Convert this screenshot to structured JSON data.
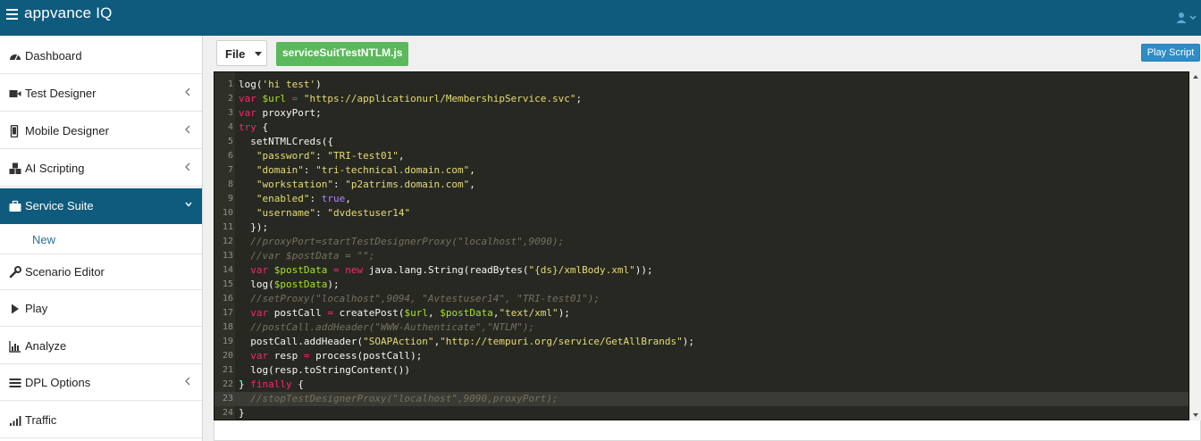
{
  "app": {
    "brand": "appvance IQ",
    "user_icon": "user-icon"
  },
  "sidebar": {
    "items": [
      {
        "label": "Dashboard",
        "icon": "dashboard-icon",
        "chevron": false,
        "active": false
      },
      {
        "label": "Test Designer",
        "icon": "video-camera-icon",
        "chevron": true,
        "active": false
      },
      {
        "label": "Mobile Designer",
        "icon": "mobile-icon",
        "chevron": true,
        "active": false
      },
      {
        "label": "AI Scripting",
        "icon": "cubes-icon",
        "chevron": true,
        "active": false
      },
      {
        "label": "Service Suite",
        "icon": "briefcase-icon",
        "chevron": true,
        "active": true
      },
      {
        "label": "Scenario Editor",
        "icon": "wrench-icon",
        "chevron": false,
        "active": false
      },
      {
        "label": "Play",
        "icon": "play-icon",
        "chevron": false,
        "active": false
      },
      {
        "label": "Analyze",
        "icon": "bar-chart-icon",
        "chevron": false,
        "active": false
      },
      {
        "label": "DPL Options",
        "icon": "list-icon",
        "chevron": true,
        "active": false
      },
      {
        "label": "Traffic",
        "icon": "signal-icon",
        "chevron": false,
        "active": false
      }
    ],
    "sub_item": {
      "label": "New"
    }
  },
  "toolbar": {
    "file_label": "File",
    "file_tab": "serviceSuitTestNTLM.js",
    "play_label": "Play Script"
  },
  "editor": {
    "lines": [
      {
        "n": "1",
        "code": "log('hi test')"
      },
      {
        "n": "2",
        "code": "var $url = \"https://applicationurl/MembershipService.svc\";"
      },
      {
        "n": "3",
        "code": "var proxyPort;"
      },
      {
        "n": "4",
        "code": "try {"
      },
      {
        "n": "5",
        "code": "  setNTMLCreds({"
      },
      {
        "n": "6",
        "code": "   \"password\": \"TRI-test01\","
      },
      {
        "n": "7",
        "code": "   \"domain\": \"tri-technical.domain.com\","
      },
      {
        "n": "8",
        "code": "   \"workstation\": \"p2atrims.domain.com\","
      },
      {
        "n": "9",
        "code": "   \"enabled\": true,"
      },
      {
        "n": "10",
        "code": "   \"username\": \"dvdestuser14\""
      },
      {
        "n": "11",
        "code": "  });"
      },
      {
        "n": "12",
        "code": "  //proxyPort=startTestDesignerProxy(\"localhost\",9090);"
      },
      {
        "n": "13",
        "code": "  //var $postData = \"\";"
      },
      {
        "n": "14",
        "code": "  var $postData = new java.lang.String(readBytes(\"{ds}/xmlBody.xml\"));"
      },
      {
        "n": "15",
        "code": "  log($postData);"
      },
      {
        "n": "16",
        "code": "  //setProxy(\"localhost\",9094, \"Avtestuser14\", \"TRI-test01\");"
      },
      {
        "n": "17",
        "code": "  var postCall = createPost($url, $postData,\"text/xml\");"
      },
      {
        "n": "18",
        "code": "  //postCall.addHeader(\"WWW-Authenticate\",\"NTLM\");"
      },
      {
        "n": "19",
        "code": "  postCall.addHeader(\"SOAPAction\",\"http://tempuri.org/service/GetAllBrands\");"
      },
      {
        "n": "20",
        "code": "  var resp = process(postCall);"
      },
      {
        "n": "21",
        "code": "  log(resp.toStringContent())"
      },
      {
        "n": "22",
        "code": "} finally {"
      },
      {
        "n": "23",
        "code": "  //stopTestDesignerProxy(\"localhost\",9090,proxyPort);"
      },
      {
        "n": "24",
        "code": "}"
      }
    ],
    "highlighted_line": 23
  },
  "colors": {
    "topbar": "#0f5b7e",
    "active_nav": "#0f5b7e",
    "file_tab": "#5cb85c",
    "play_button": "#2d8dc6",
    "editor_bg": "#272822"
  }
}
